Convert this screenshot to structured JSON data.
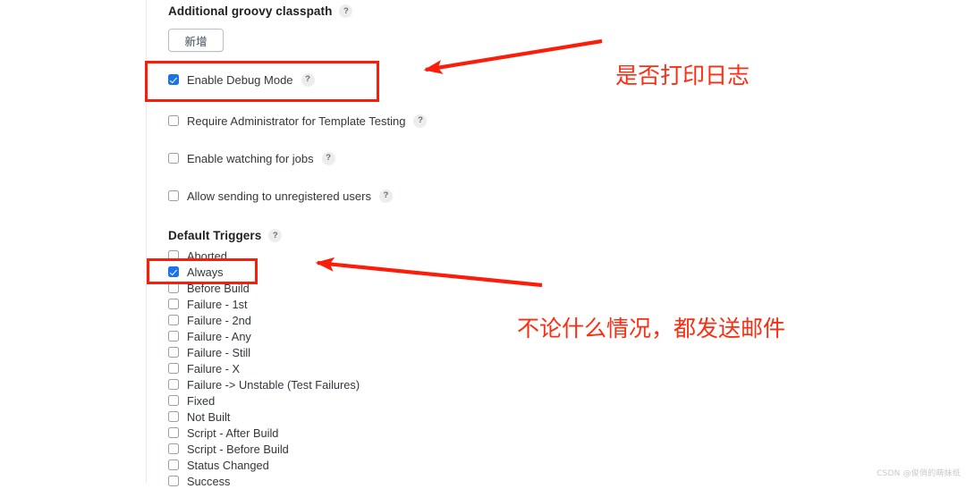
{
  "colors": {
    "annotation_red": "#fb1d09",
    "checkbox_blue": "#1a73e8",
    "text": "#32373c",
    "page_background": "#ffffff"
  },
  "groovy_section": {
    "title": "Additional groovy classpath",
    "help_icon": "?",
    "add_button_label": "新增"
  },
  "options": [
    {
      "label": "Enable Debug Mode",
      "checked": true,
      "help_icon": "?"
    },
    {
      "label": "Require Administrator for Template Testing",
      "checked": false,
      "help_icon": "?"
    },
    {
      "label": "Enable watching for jobs",
      "checked": false,
      "help_icon": "?"
    },
    {
      "label": "Allow sending to unregistered users",
      "checked": false,
      "help_icon": "?"
    }
  ],
  "triggers_section": {
    "title": "Default Triggers",
    "help_icon": "?"
  },
  "triggers": [
    {
      "label": "Aborted",
      "checked": false
    },
    {
      "label": "Always",
      "checked": true
    },
    {
      "label": "Before Build",
      "checked": false
    },
    {
      "label": "Failure - 1st",
      "checked": false
    },
    {
      "label": "Failure - 2nd",
      "checked": false
    },
    {
      "label": "Failure - Any",
      "checked": false
    },
    {
      "label": "Failure - Still",
      "checked": false
    },
    {
      "label": "Failure - X",
      "checked": false
    },
    {
      "label": "Failure -> Unstable (Test Failures)",
      "checked": false
    },
    {
      "label": "Fixed",
      "checked": false
    },
    {
      "label": "Not Built",
      "checked": false
    },
    {
      "label": "Script - After Build",
      "checked": false
    },
    {
      "label": "Script - Before Build",
      "checked": false
    },
    {
      "label": "Status Changed",
      "checked": false
    },
    {
      "label": "Success",
      "checked": false
    }
  ],
  "annotations": {
    "debug_note": "是否打印日志",
    "always_note": "不论什么情况，都发送邮件"
  },
  "watermark": "CSDN @俊俏的萌妹纸"
}
